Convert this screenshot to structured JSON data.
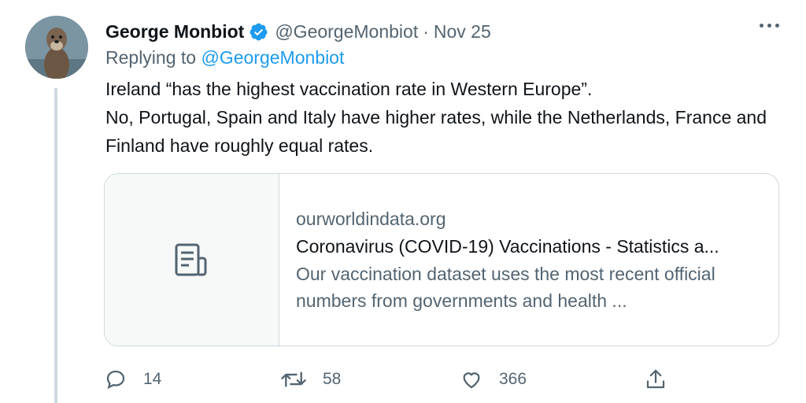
{
  "author": {
    "name": "George Monbiot",
    "handle": "@GeorgeMonbiot",
    "separator": "·",
    "date": "Nov 25",
    "avatar_icon": "otter-avatar",
    "verified_icon": "verified-badge-icon"
  },
  "replying": {
    "prefix": "Replying to",
    "target": "@GeorgeMonbiot"
  },
  "tweet": {
    "text": "Ireland “has the highest vaccination rate in Western Europe”.\nNo, Portugal, Spain and Italy have higher rates, while the Netherlands, France and Finland have roughly equal rates."
  },
  "card": {
    "icon": "document-icon",
    "domain": "ourworldindata.org",
    "title": "Coronavirus (COVID-19) Vaccinations - Statistics a...",
    "description": "Our vaccination dataset uses the most recent official numbers from governments and health ..."
  },
  "actions": {
    "reply_count": "14",
    "retweet_count": "58",
    "like_count": "366"
  },
  "colors": {
    "accent": "#1d9bf0",
    "secondary_text": "#536471",
    "border": "#cfd9de"
  }
}
